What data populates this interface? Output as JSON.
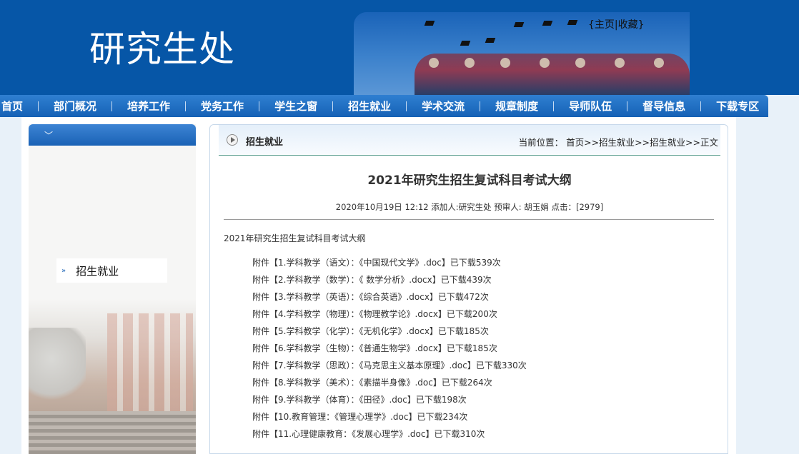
{
  "header": {
    "site_title": "研究生处",
    "top_links_open": "{",
    "home_link": "主页",
    "separator": "|",
    "favorite_link": "收藏",
    "top_links_close": "}"
  },
  "nav": {
    "items": [
      "首页",
      "部门概况",
      "培养工作",
      "党务工作",
      "学生之窗",
      "招生就业",
      "学术交流",
      "规章制度",
      "导师队伍",
      "督导信息",
      "下载专区"
    ]
  },
  "sidebar": {
    "chevron_icon": "chevron-down-icon",
    "item_label": "招生就业",
    "arrow_icon": "double-arrow-icon"
  },
  "content": {
    "category": "招生就业",
    "breadcrumb": {
      "prefix": "当前位置：",
      "path": [
        "首页",
        "招生就业",
        "招生就业",
        "正文"
      ],
      "sep": ">>"
    },
    "article": {
      "title": "2021年研究生招生复试科目考试大纲",
      "meta": "2020年10月19日 12:12 添加人:研究生处  预审人: 胡玉娟  点击：[2979]",
      "intro": "2021年研究生招生复试科目考试大纲",
      "attachments": [
        "附件【1.学科教学（语文）：《中国现代文学》.doc】已下载539次",
        "附件【2.学科教学（数学）：《 数学分析》.docx】已下载439次",
        "附件【3.学科教学（英语）：《综合英语》.docx】已下载472次",
        "附件【4.学科教学（物理）：《物理教学论》.docx】已下载200次",
        "附件【5.学科教学（化学）：《无机化学》.docx】已下载185次",
        "附件【6.学科教学（生物）：《普通生物学》.docx】已下载185次",
        "附件【7.学科教学（思政）：《马克思主义基本原理》.doc】已下载330次",
        "附件【8.学科教学（美术）：《素描半身像》.doc】已下载264次",
        "附件【9.学科教学（体育）：《田径》.doc】已下载198次",
        "附件【10.教育管理：《管理心理学》.doc】已下载234次",
        "附件【11.心理健康教育：《发展心理学》.doc】已下载310次"
      ]
    }
  }
}
